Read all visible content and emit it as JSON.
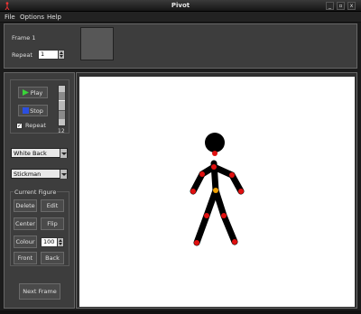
{
  "window": {
    "title": "Pivot",
    "minimize_glyph": "_",
    "maximize_glyph": "▫",
    "close_glyph": "x"
  },
  "menu": {
    "items": [
      "File",
      "Options",
      "Help"
    ]
  },
  "framebar": {
    "frame_label": "Frame 1",
    "repeat_label": "Repeat",
    "repeat_value": "1"
  },
  "playback": {
    "play_label": "Play",
    "stop_label": "Stop",
    "repeat_label": "Repeat",
    "repeat_checked": true,
    "speed_value": "12"
  },
  "background_select": {
    "value": "White Back"
  },
  "figure_type_select": {
    "value": "Stickman"
  },
  "current_figure": {
    "title": "Current Figure",
    "delete_label": "Delete",
    "edit_label": "Edit",
    "center_label": "Center",
    "flip_label": "Flip",
    "colour_label": "Colour",
    "size_value": "100",
    "front_label": "Front",
    "back_label": "Back"
  },
  "next_frame_label": "Next Frame",
  "colors": {
    "canvas": "#ffffff",
    "figure": "#000000",
    "handle": "#e01010",
    "center_handle": "#f0a000"
  },
  "icons": {
    "app": "stickman-app-icon",
    "play": "play-icon",
    "stop": "stop-icon"
  }
}
